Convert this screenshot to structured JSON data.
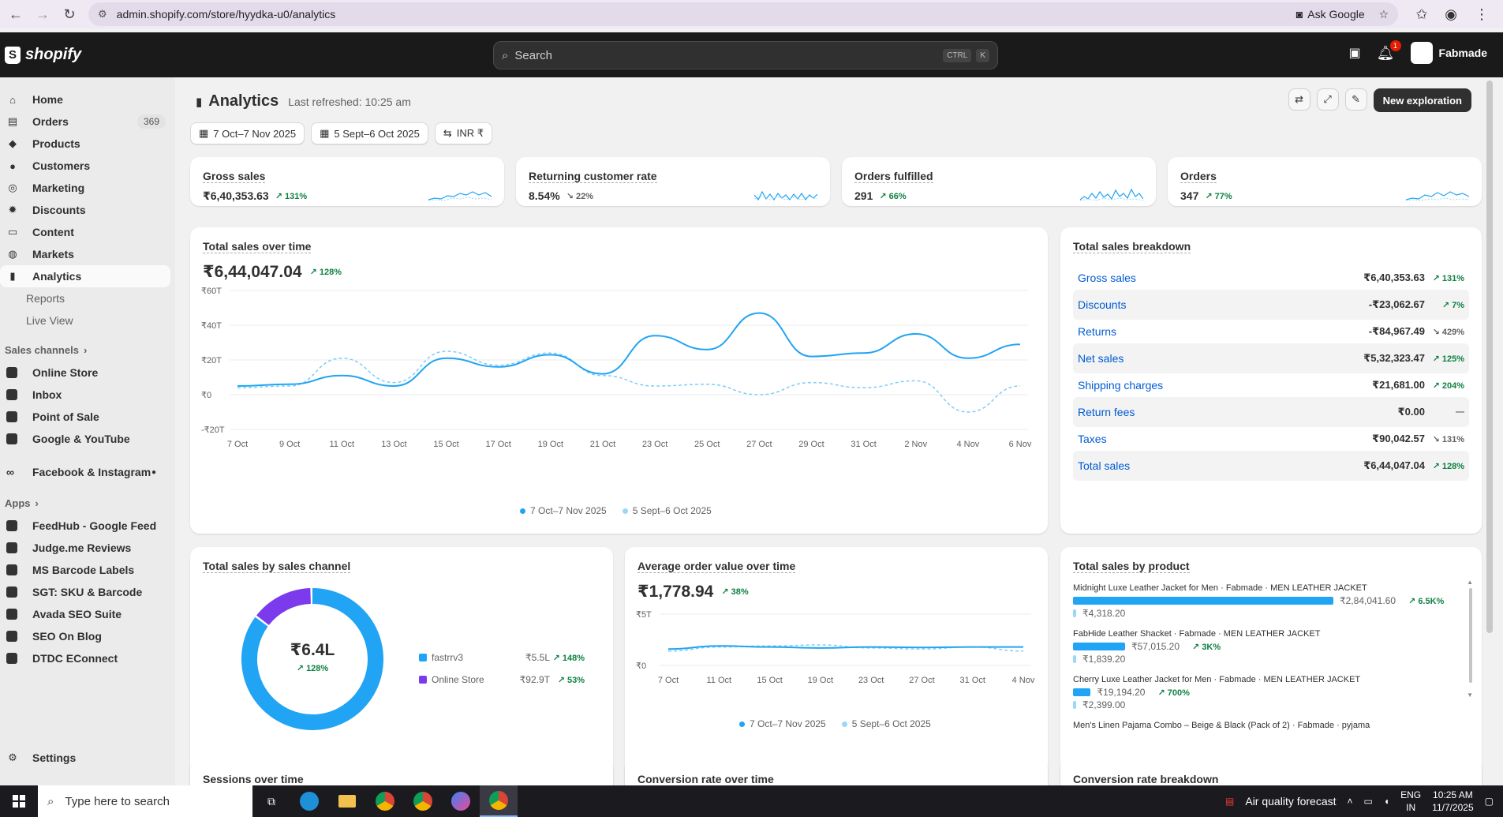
{
  "browser": {
    "url": "admin.shopify.com/store/hyydka-u0/analytics",
    "ask_google": "Ask Google"
  },
  "topbar": {
    "brand": "shopify",
    "search_placeholder": "Search",
    "kbd1": "CTRL",
    "kbd2": "K",
    "notif_count": "1",
    "store_name": "Fabmade"
  },
  "sidebar": {
    "items": [
      {
        "label": "Home",
        "icon": "home-icon"
      },
      {
        "label": "Orders",
        "icon": "orders-icon",
        "badge": "369"
      },
      {
        "label": "Products",
        "icon": "tag-icon"
      },
      {
        "label": "Customers",
        "icon": "person-icon"
      },
      {
        "label": "Marketing",
        "icon": "target-icon"
      },
      {
        "label": "Discounts",
        "icon": "discount-icon"
      },
      {
        "label": "Content",
        "icon": "content-icon"
      },
      {
        "label": "Markets",
        "icon": "globe-icon"
      },
      {
        "label": "Analytics",
        "icon": "chart-icon"
      }
    ],
    "sub_items": [
      "Reports",
      "Live View"
    ],
    "sales_channels_label": "Sales channels",
    "channels": [
      "Online Store",
      "Inbox",
      "Point of Sale",
      "Google & YouTube",
      "Facebook & Instagram"
    ],
    "apps_label": "Apps",
    "apps": [
      "FeedHub - Google Feed",
      "Judge.me Reviews",
      "MS Barcode Labels",
      "SGT: SKU & Barcode",
      "Avada SEO Suite",
      "SEO On Blog",
      "DTDC EConnect"
    ],
    "settings": "Settings"
  },
  "page": {
    "title": "Analytics",
    "last_refreshed": "Last refreshed: 10:25 am",
    "new_exploration": "New exploration",
    "filters": {
      "date": "7 Oct–7 Nov 2025",
      "compare": "5 Sept–6 Oct 2025",
      "currency": "INR ₹"
    }
  },
  "kpis": [
    {
      "title": "Gross sales",
      "value": "₹6,40,353.63",
      "change": "131%",
      "positive": true
    },
    {
      "title": "Returning customer rate",
      "value": "8.54%",
      "change": "22%",
      "positive": false
    },
    {
      "title": "Orders fulfilled",
      "value": "291",
      "change": "66%",
      "positive": true
    },
    {
      "title": "Orders",
      "value": "347",
      "change": "77%",
      "positive": true
    }
  ],
  "total_sales": {
    "title": "Total sales over time",
    "value": "₹6,44,047.04",
    "change": "128%",
    "legend_current": "7 Oct–7 Nov 2025",
    "legend_previous": "5 Sept–6 Oct 2025"
  },
  "breakdown": {
    "title": "Total sales breakdown",
    "rows": [
      {
        "label": "Gross sales",
        "value": "₹6,40,353.63",
        "change": "131%",
        "positive": true
      },
      {
        "label": "Discounts",
        "value": "-₹23,062.67",
        "change": "7%",
        "positive": true
      },
      {
        "label": "Returns",
        "value": "-₹84,967.49",
        "change": "429%",
        "positive": false
      },
      {
        "label": "Net sales",
        "value": "₹5,32,323.47",
        "change": "125%",
        "positive": true
      },
      {
        "label": "Shipping charges",
        "value": "₹21,681.00",
        "change": "204%",
        "positive": true
      },
      {
        "label": "Return fees",
        "value": "₹0.00",
        "change": "—",
        "positive": false
      },
      {
        "label": "Taxes",
        "value": "₹90,042.57",
        "change": "131%",
        "positive": false
      },
      {
        "label": "Total sales",
        "value": "₹6,44,047.04",
        "change": "128%",
        "positive": true
      }
    ]
  },
  "by_channel": {
    "title": "Total sales by sales channel",
    "center_value": "₹6.4L",
    "center_change": "128%",
    "items": [
      {
        "name": "fastrrv3",
        "value": "₹5.5L",
        "change": "148%",
        "color": "#20a4f3"
      },
      {
        "name": "Online Store",
        "value": "₹92.9T",
        "change": "53%",
        "color": "#7c3aed"
      }
    ]
  },
  "aov": {
    "title": "Average order value over time",
    "value": "₹1,778.94",
    "change": "38%",
    "legend_current": "7 Oct–7 Nov 2025",
    "legend_previous": "5 Sept–6 Oct 2025"
  },
  "by_product": {
    "title": "Total sales by product",
    "items": [
      {
        "name": "Midnight Luxe Leather Jacket for Men · Fabmade · MEN LEATHER JACKET",
        "value": "₹2,84,041.60",
        "change": "6.5K%",
        "prev": "₹4,318.20",
        "share": 1.0
      },
      {
        "name": "FabHide Leather Shacket · Fabmade · MEN LEATHER JACKET",
        "value": "₹57,015.20",
        "change": "3K%",
        "prev": "₹1,839.20",
        "share": 0.2
      },
      {
        "name": "Cherry Luxe Leather Jacket for Men · Fabmade · MEN LEATHER JACKET",
        "value": "₹19,194.20",
        "change": "700%",
        "prev": "₹2,399.00",
        "share": 0.068
      },
      {
        "name": "Men's Linen Pajama Combo – Beige & Black (Pack of 2) · Fabmade · pyjama",
        "value": "",
        "change": "",
        "prev": "",
        "share": 0
      }
    ]
  },
  "bottom_titles": {
    "sessions": "Sessions over time",
    "conversion": "Conversion rate over time",
    "conversion_breakdown": "Conversion rate breakdown"
  },
  "chart_data": [
    {
      "type": "line",
      "title": "Total sales over time",
      "x": [
        "7 Oct",
        "9 Oct",
        "11 Oct",
        "13 Oct",
        "15 Oct",
        "17 Oct",
        "19 Oct",
        "21 Oct",
        "23 Oct",
        "25 Oct",
        "27 Oct",
        "29 Oct",
        "31 Oct",
        "2 Nov",
        "4 Nov",
        "6 Nov"
      ],
      "y_ticks": [
        "₹60T",
        "₹40T",
        "₹20T",
        "₹0",
        "-₹20T"
      ],
      "ylim": [
        -20000,
        60000
      ],
      "series": [
        {
          "name": "7 Oct–7 Nov 2025",
          "color": "#20a4f3",
          "values": [
            5000,
            6000,
            11000,
            5000,
            21000,
            16000,
            23000,
            12000,
            34000,
            26000,
            47000,
            22000,
            24000,
            35000,
            21000,
            29000
          ]
        },
        {
          "name": "5 Sept–6 Oct 2025",
          "color": "#7fcdf7",
          "values": [
            4000,
            5000,
            21000,
            7000,
            25000,
            17000,
            24000,
            11000,
            5000,
            6000,
            0,
            7000,
            4000,
            8000,
            -10000,
            5000
          ]
        }
      ]
    },
    {
      "type": "pie",
      "title": "Total sales by sales channel",
      "categories": [
        "fastrrv3",
        "Online Store"
      ],
      "values": [
        550000,
        92900
      ]
    },
    {
      "type": "line",
      "title": "Average order value over time",
      "x": [
        "7 Oct",
        "11 Oct",
        "15 Oct",
        "19 Oct",
        "23 Oct",
        "27 Oct",
        "31 Oct",
        "4 Nov"
      ],
      "y_ticks": [
        "₹5T",
        "₹0"
      ],
      "ylim": [
        0,
        5000
      ],
      "series": [
        {
          "name": "7 Oct–7 Nov 2025",
          "color": "#20a4f3",
          "values": [
            1600,
            1900,
            1800,
            1700,
            1800,
            1750,
            1800,
            1800
          ]
        },
        {
          "name": "5 Sept–6 Oct 2025",
          "color": "#7fcdf7",
          "values": [
            1400,
            1800,
            1900,
            2000,
            1700,
            1600,
            1800,
            1400
          ]
        }
      ]
    }
  ]
}
